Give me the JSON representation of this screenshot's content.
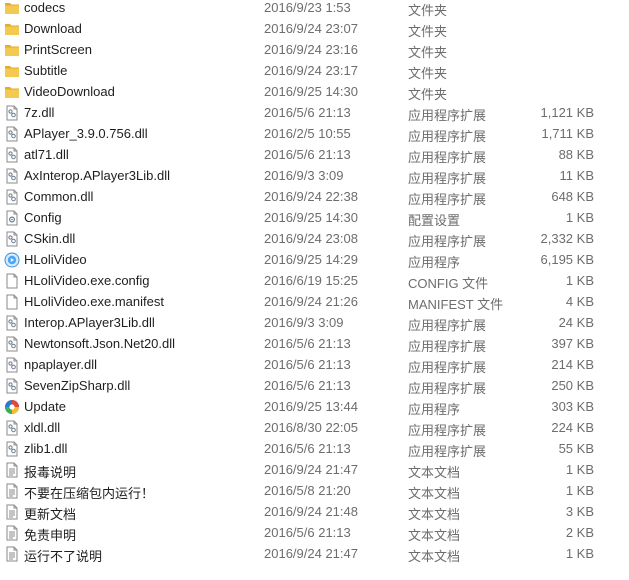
{
  "files": [
    {
      "name": "codecs",
      "date": "2016/9/23 1:53",
      "type": "文件夹",
      "size": "",
      "icon": "folder-icon"
    },
    {
      "name": "Download",
      "date": "2016/9/24 23:07",
      "type": "文件夹",
      "size": "",
      "icon": "folder-icon"
    },
    {
      "name": "PrintScreen",
      "date": "2016/9/24 23:16",
      "type": "文件夹",
      "size": "",
      "icon": "folder-icon"
    },
    {
      "name": "Subtitle",
      "date": "2016/9/24 23:17",
      "type": "文件夹",
      "size": "",
      "icon": "folder-icon"
    },
    {
      "name": "VideoDownload",
      "date": "2016/9/25 14:30",
      "type": "文件夹",
      "size": "",
      "icon": "folder-icon"
    },
    {
      "name": "7z.dll",
      "date": "2016/5/6 21:13",
      "type": "应用程序扩展",
      "size": "1,121 KB",
      "icon": "dll-file-icon"
    },
    {
      "name": "APlayer_3.9.0.756.dll",
      "date": "2016/2/5 10:55",
      "type": "应用程序扩展",
      "size": "1,711 KB",
      "icon": "dll-file-icon"
    },
    {
      "name": "atl71.dll",
      "date": "2016/5/6 21:13",
      "type": "应用程序扩展",
      "size": "88 KB",
      "icon": "dll-file-icon"
    },
    {
      "name": "AxInterop.APlayer3Lib.dll",
      "date": "2016/9/3 3:09",
      "type": "应用程序扩展",
      "size": "11 KB",
      "icon": "dll-file-icon"
    },
    {
      "name": "Common.dll",
      "date": "2016/9/24 22:38",
      "type": "应用程序扩展",
      "size": "648 KB",
      "icon": "dll-file-icon"
    },
    {
      "name": "Config",
      "date": "2016/9/25 14:30",
      "type": "配置设置",
      "size": "1 KB",
      "icon": "config-file-icon"
    },
    {
      "name": "CSkin.dll",
      "date": "2016/9/24 23:08",
      "type": "应用程序扩展",
      "size": "2,332 KB",
      "icon": "dll-file-icon"
    },
    {
      "name": "HLoliVideo",
      "date": "2016/9/25 14:29",
      "type": "应用程序",
      "size": "6,195 KB",
      "icon": "hlolivideo-app-icon"
    },
    {
      "name": "HLoliVideo.exe.config",
      "date": "2016/6/19 15:25",
      "type": "CONFIG 文件",
      "size": "1 KB",
      "icon": "blank-file-icon"
    },
    {
      "name": "HLoliVideo.exe.manifest",
      "date": "2016/9/24 21:26",
      "type": "MANIFEST 文件",
      "size": "4 KB",
      "icon": "blank-file-icon"
    },
    {
      "name": "Interop.APlayer3Lib.dll",
      "date": "2016/9/3 3:09",
      "type": "应用程序扩展",
      "size": "24 KB",
      "icon": "dll-file-icon"
    },
    {
      "name": "Newtonsoft.Json.Net20.dll",
      "date": "2016/5/6 21:13",
      "type": "应用程序扩展",
      "size": "397 KB",
      "icon": "dll-file-icon"
    },
    {
      "name": "npaplayer.dll",
      "date": "2016/5/6 21:13",
      "type": "应用程序扩展",
      "size": "214 KB",
      "icon": "dll-file-icon"
    },
    {
      "name": "SevenZipSharp.dll",
      "date": "2016/5/6 21:13",
      "type": "应用程序扩展",
      "size": "250 KB",
      "icon": "dll-file-icon"
    },
    {
      "name": "Update",
      "date": "2016/9/25 13:44",
      "type": "应用程序",
      "size": "303 KB",
      "icon": "update-app-icon"
    },
    {
      "name": "xldl.dll",
      "date": "2016/8/30 22:05",
      "type": "应用程序扩展",
      "size": "224 KB",
      "icon": "dll-file-icon"
    },
    {
      "name": "zlib1.dll",
      "date": "2016/5/6 21:13",
      "type": "应用程序扩展",
      "size": "55 KB",
      "icon": "dll-file-icon"
    },
    {
      "name": "报毒说明",
      "date": "2016/9/24 21:47",
      "type": "文本文档",
      "size": "1 KB",
      "icon": "text-file-icon"
    },
    {
      "name": "不要在压缩包内运行！",
      "date": "2016/5/8 21:20",
      "type": "文本文档",
      "size": "1 KB",
      "icon": "text-file-icon"
    },
    {
      "name": "更新文档",
      "date": "2016/9/24 21:48",
      "type": "文本文档",
      "size": "3 KB",
      "icon": "text-file-icon"
    },
    {
      "name": "免责申明",
      "date": "2016/5/6 21:13",
      "type": "文本文档",
      "size": "2 KB",
      "icon": "text-file-icon"
    },
    {
      "name": "运行不了说明",
      "date": "2016/9/24 21:47",
      "type": "文本文档",
      "size": "1 KB",
      "icon": "text-file-icon"
    }
  ],
  "colors": {
    "folder": "#f3c94f",
    "folder_dark": "#e2ad2c",
    "text": "#1e1e1e",
    "muted": "#6d6d6d"
  }
}
